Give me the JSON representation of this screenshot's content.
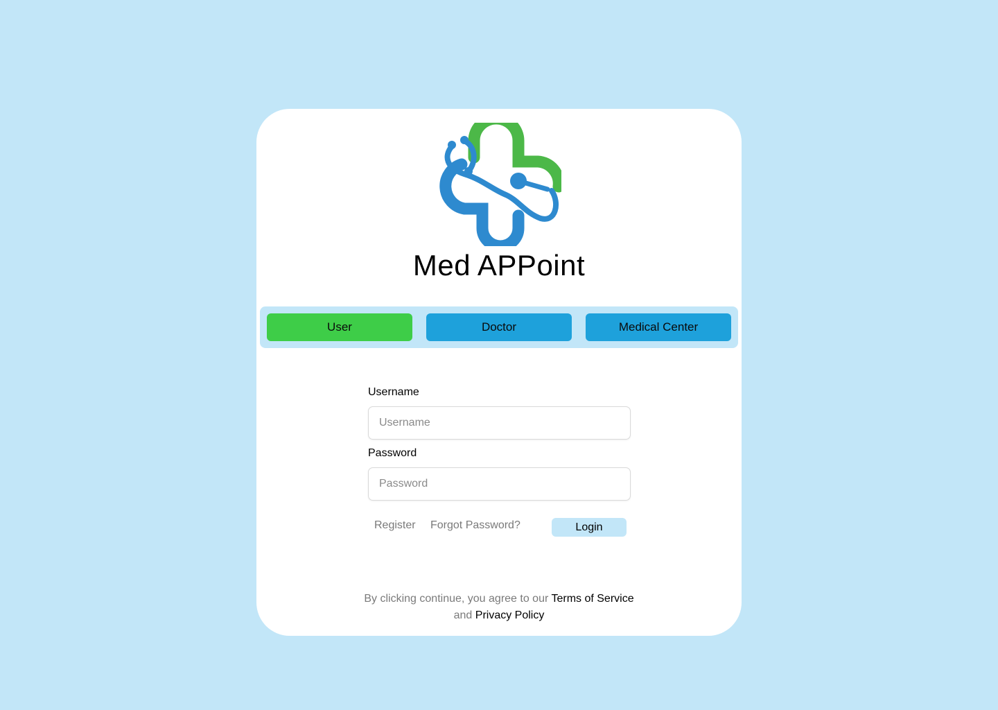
{
  "app": {
    "title": "Med APPoint",
    "logo_icon": "medical-cross-stethoscope-logo"
  },
  "roles": {
    "selected": "User",
    "items": [
      {
        "label": "User",
        "color": "#3ecd48"
      },
      {
        "label": "Doctor",
        "color": "#1ea1db"
      },
      {
        "label": "Medical Center",
        "color": "#1ea1db"
      }
    ]
  },
  "form": {
    "username_label": "Username",
    "username_placeholder": "Username",
    "username_value": "",
    "password_label": "Password",
    "password_placeholder": "Password",
    "password_value": ""
  },
  "actions": {
    "register": "Register",
    "forgot_password": "Forgot Password?",
    "login": "Login"
  },
  "legal": {
    "prefix": "By clicking continue, you agree to our",
    "terms": "Terms of Service",
    "conjunction": "and",
    "privacy": "Privacy Policy"
  },
  "colors": {
    "background": "#c2e6f8",
    "selected_role": "#3ecd48",
    "role": "#1ea1db",
    "logo_green": "#4cb848",
    "logo_blue": "#2e8acf"
  }
}
